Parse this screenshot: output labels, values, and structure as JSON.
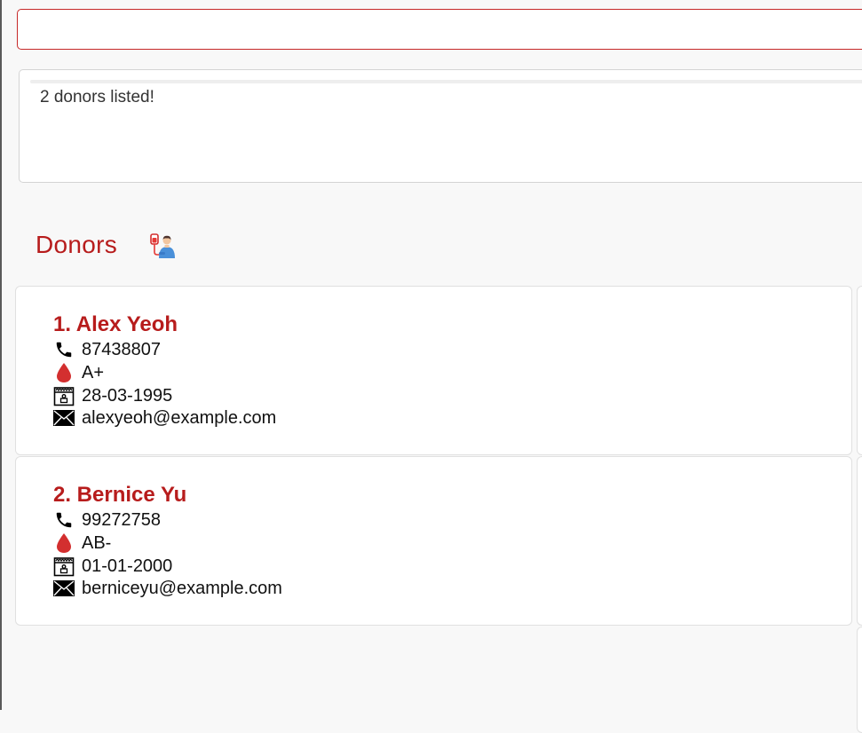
{
  "command_box": {
    "value": "",
    "placeholder": ""
  },
  "result_display": {
    "text": "2 donors listed!"
  },
  "donor_list": {
    "title": "Donors",
    "icon": "blood-donation-icon",
    "donors": [
      {
        "index_name": "1. Alex Yeoh",
        "phone": "87438807",
        "blood_type": "A+",
        "dob": "28-03-1995",
        "email": "alexyeoh@example.com"
      },
      {
        "index_name": "2. Bernice Yu",
        "phone": "99272758",
        "blood_type": "AB-",
        "dob": "01-01-2000",
        "email": "berniceyu@example.com"
      }
    ]
  },
  "icons": {
    "phone": "phone-icon",
    "blood_type": "blood-drop-icon",
    "dob": "birthday-calendar-icon",
    "email": "envelope-icon"
  },
  "colors": {
    "accent": "#b71c1c",
    "command_border": "#c62828",
    "blood_drop": "#d32f2f",
    "card_border": "#e0e0e0",
    "background": "#f8f8f8"
  }
}
